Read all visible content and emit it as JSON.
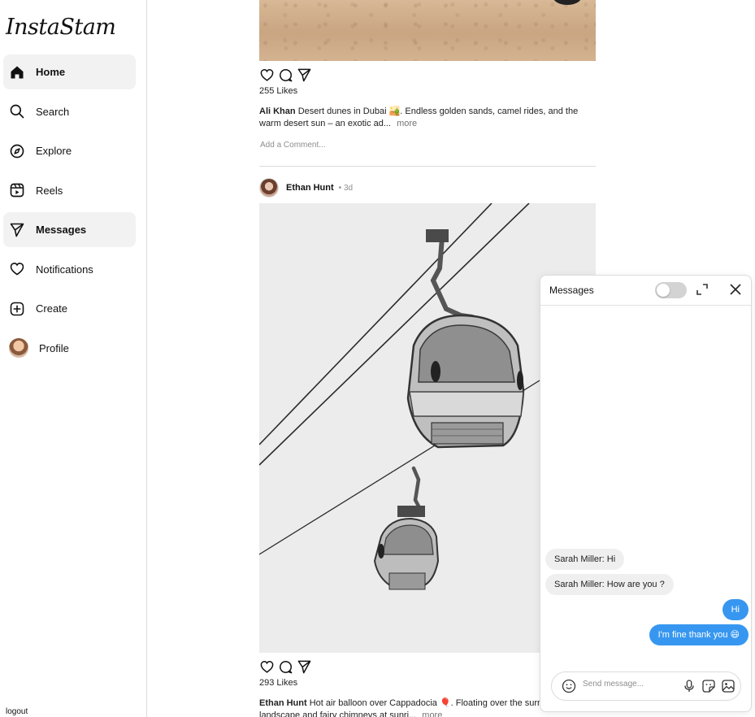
{
  "app": {
    "logo": "InstaStam"
  },
  "sidebar": {
    "items": [
      {
        "label": "Home",
        "icon": "home-icon",
        "active": true
      },
      {
        "label": "Search",
        "icon": "search-icon",
        "active": false
      },
      {
        "label": "Explore",
        "icon": "compass-icon",
        "active": false
      },
      {
        "label": "Reels",
        "icon": "reels-icon",
        "active": false
      },
      {
        "label": "Messages",
        "icon": "send-icon",
        "active": true
      },
      {
        "label": "Notifications",
        "icon": "heart-icon",
        "active": false
      },
      {
        "label": "Create",
        "icon": "plus-square-icon",
        "active": false
      },
      {
        "label": "Profile",
        "icon": "avatar",
        "active": false
      }
    ],
    "logout": "logout"
  },
  "feed": {
    "post1": {
      "likes": "255 Likes",
      "author": "Ali Khan",
      "caption": "Desert dunes in Dubai 🏜️. Endless golden sands, camel rides, and the warm desert sun – an exotic ad...",
      "more": "more",
      "add_comment_placeholder": "Add a Comment..."
    },
    "post2": {
      "user": "Ethan Hunt",
      "time": "• 3d",
      "likes": "293 Likes",
      "author": "Ethan Hunt",
      "caption": "Hot air balloon over Cappadocia 🎈. Floating over the surreal landscape and fairy chimneys at sunri...",
      "more": "more"
    }
  },
  "messages": {
    "title": "Messages",
    "conversation": [
      {
        "from": "them",
        "text": "Sarah Miller: Hi"
      },
      {
        "from": "them",
        "text": "Sarah Miller: How are you ?"
      },
      {
        "from": "me",
        "text": "Hi"
      },
      {
        "from": "me",
        "text": "I'm fine thank you 😄"
      }
    ],
    "composer_placeholder": "Send message...",
    "colors": {
      "outgoing": "#3797f0",
      "incoming": "#efefef"
    }
  }
}
